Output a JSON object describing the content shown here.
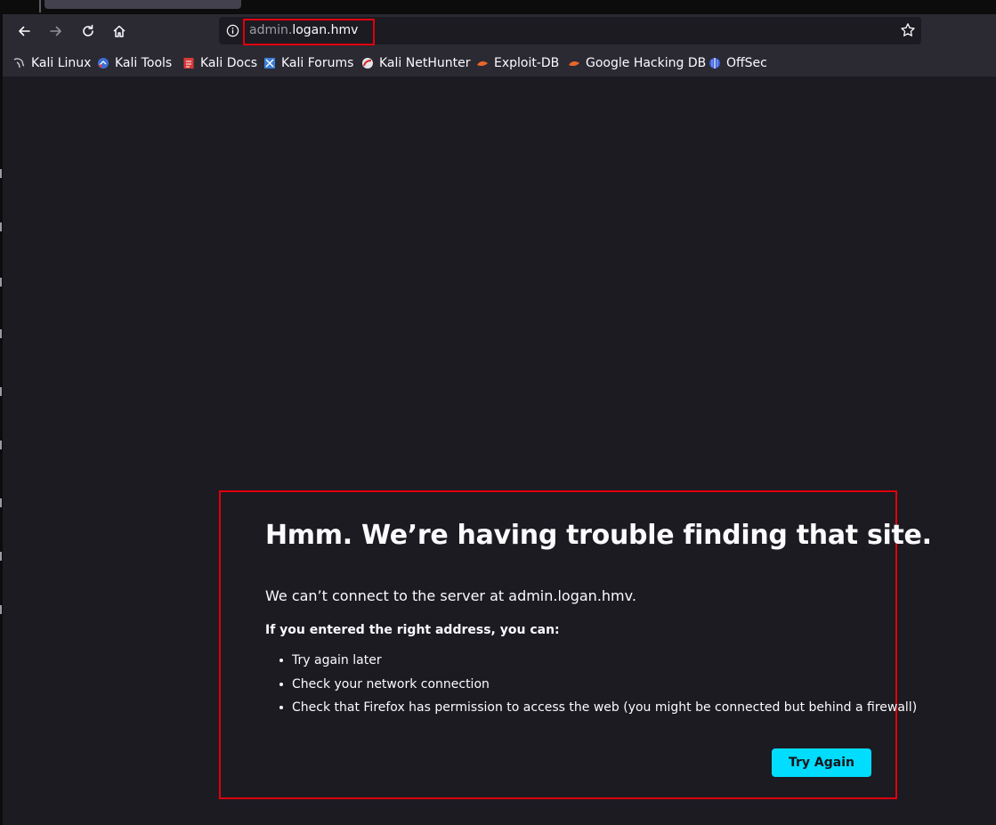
{
  "browser": {
    "url": {
      "subdomain": "admin.",
      "host": "logan.hmv"
    },
    "nav_icons": [
      "back-icon",
      "forward-icon",
      "reload-icon",
      "home-icon"
    ],
    "url_icons": [
      "info-icon",
      "bookmark-star-icon"
    ]
  },
  "bookmarks": [
    {
      "label": "Kali Linux",
      "icon": "kali-dragon-icon"
    },
    {
      "label": "Kali Tools",
      "icon": "kali-tools-icon"
    },
    {
      "label": "Kali Docs",
      "icon": "kali-docs-icon"
    },
    {
      "label": "Kali Forums",
      "icon": "kali-forums-icon"
    },
    {
      "label": "Kali NetHunter",
      "icon": "kali-nethunter-icon"
    },
    {
      "label": "Exploit-DB",
      "icon": "exploit-db-icon"
    },
    {
      "label": "Google Hacking DB",
      "icon": "ghdb-icon"
    },
    {
      "label": "OffSec",
      "icon": "offsec-icon"
    }
  ],
  "error_page": {
    "title": "Hmm. We’re having trouble finding that site.",
    "description": "We can’t connect to the server at admin.logan.hmv.",
    "subtitle": "If you entered the right address, you can:",
    "suggestions": [
      "Try again later",
      "Check your network connection",
      "Check that Firefox has permission to access the web (you might be connected but behind a firewall)"
    ],
    "button_label": "Try Again"
  },
  "colors": {
    "chrome_bg": "#2b2a33",
    "page_bg": "#1c1b22",
    "highlight_red": "#e0000d",
    "button_cyan": "#00ddff"
  }
}
